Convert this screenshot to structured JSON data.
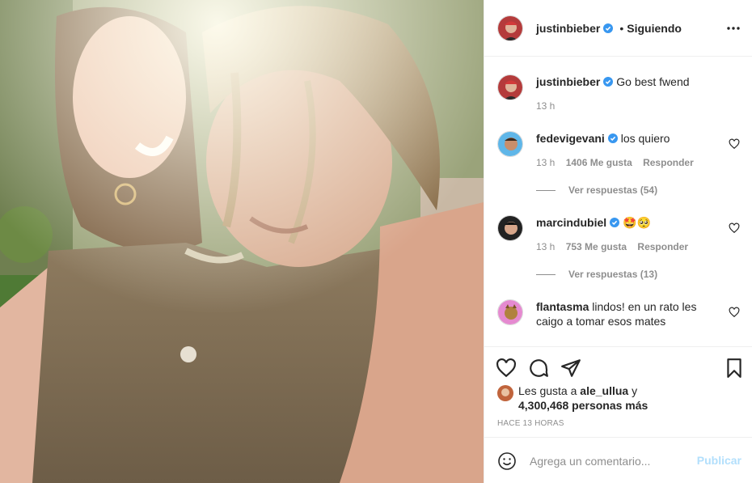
{
  "post": {
    "author": "justinbieber",
    "follow_status": "Siguiendo",
    "separator": "•",
    "caption": "Go best fwend",
    "caption_time": "13 h"
  },
  "comments": [
    {
      "username": "fedevigevani",
      "verified": true,
      "text": "los quiero",
      "time": "13 h",
      "likes": "1406 Me gusta",
      "reply": "Responder",
      "view_replies": "Ver respuestas (54)"
    },
    {
      "username": "marcindubiel",
      "verified": true,
      "text": "🤩🥺",
      "time": "13 h",
      "likes": "753 Me gusta",
      "reply": "Responder",
      "view_replies": "Ver respuestas (13)"
    },
    {
      "username": "flantasma",
      "verified": false,
      "text": "lindos! en un rato les caigo a tomar esos mates"
    }
  ],
  "likes": {
    "prefix": "Les gusta a",
    "user": "ale_ullua",
    "connector": "y",
    "count": "4,300,468 personas más"
  },
  "timestamp": "Hace 13 horas",
  "add_comment": {
    "placeholder": "Agrega un comentario...",
    "publish": "Publicar"
  },
  "colors": {
    "verified": "#3897f0",
    "publish": "#b2dffc",
    "muted": "#8e8e8e",
    "text": "#262626"
  },
  "icons": [
    "more-options-icon",
    "verified-badge-icon",
    "heart-icon",
    "comment-icon",
    "share-icon",
    "bookmark-icon",
    "emoji-icon"
  ]
}
